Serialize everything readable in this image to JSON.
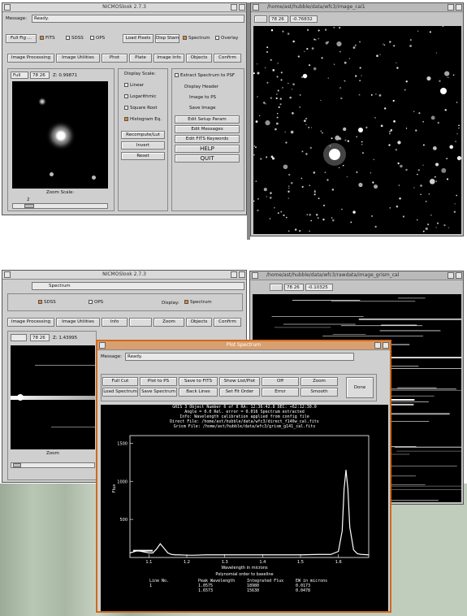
{
  "top_main": {
    "title": "NICMOSlook 2.7.3",
    "message_label": "Message:",
    "message_value": "Ready.",
    "row1": [
      "Full Fig ...",
      "FITS",
      "SDSS",
      "OPS",
      "Load Pixels",
      "Disp Stamp",
      "Spectrum",
      "Overlay"
    ],
    "row2": [
      "Image Processing",
      "Image Utilities",
      "Phot",
      "Plate",
      "Image Info",
      "Objects",
      "Confirm"
    ],
    "zoom_field": "Full",
    "coord_field": "78 26",
    "coord_value": "Z: 0.99871",
    "zoom_label": "Zoom Scale:",
    "zoom_value": "2",
    "display_scale_title": "Display Scale:",
    "scales": [
      "Linear",
      "Logarithmic",
      "Square Root",
      "Histogram Eq."
    ],
    "scale_buttons": [
      "Recompute/Lut",
      "Invert",
      "Reset"
    ],
    "right_options": [
      "Extract Spectrum to PSF",
      "Display Header",
      "Image to PS",
      "Save Image"
    ],
    "right_buttons": [
      "Edit Setup Param",
      "Edit Messages",
      "Edit FITS Keywords",
      "HELP",
      "QUIT"
    ]
  },
  "top_image": {
    "title": "/home/ast/hubble/data/wfc3/image_cal1",
    "coord_field": "78 26",
    "value_field": "-0.76832"
  },
  "bottom_main": {
    "title": "NICMOSlook 2.7.3",
    "status_text": "Spectrum",
    "opts": [
      "SDSS",
      "OPS"
    ],
    "display_label": "Display:",
    "display_value": "Spectrum",
    "row2": [
      "Image Processing",
      "Image Utilities",
      "Info",
      "Zoom",
      "Objects",
      "Confirm"
    ],
    "coord_field": "78 26",
    "coord_value": "Z: 1.43995",
    "zoom_label": "Zoom"
  },
  "bottom_image": {
    "title": "/home/ast/hubble/data/wfc3/rawdata/image_grism_cal",
    "coord_field": "78 26",
    "value_field": "-0.10325"
  },
  "plot_window": {
    "title": "Plot Spectrum",
    "message_label": "Message:",
    "message_value": "Ready.",
    "buttons_row1": [
      "Full Cut",
      "Plot to PS",
      "Save to FITS",
      "Show List/Plot",
      "Off",
      "Zoom"
    ],
    "buttons_row2": [
      "Load Spectrum",
      "Save Spectrum",
      "Back Lines",
      "Set Fit Order",
      "Error",
      "Smooth"
    ],
    "side_button": "Done",
    "header_lines": [
      "GRIS 3   Object Number 6 of 8   RA: 12:36:42.8  DEC: +62:12:30.0",
      "Angle = 0.0  Rel. error = 0.016  Spectrum extracted",
      "Info: Wavelength calibration applied from config file",
      "Direct File: /home/ast/hubble/data/wfc3/direct_f140w_cal.fits",
      "Grism File: /home/ast/hubble/data/wfc3/grism_g141_cal.fits"
    ],
    "x_label": "Wavelength in microns",
    "y_label": "Flux",
    "footer_title": "Polynomial order to baseline",
    "footer_headers": [
      "Line No.",
      "Peak Wavelength",
      "Integrated Flux",
      "EW in microns"
    ],
    "footer_values": [
      "1",
      "1.0575",
      "18980",
      "0.0173"
    ],
    "footer_values2": [
      "",
      "1.6573",
      "15630",
      "0.0478"
    ]
  },
  "chart_data": {
    "type": "line",
    "xlabel": "Wavelength in microns",
    "ylabel": "Flux",
    "yticks": [
      500,
      1000,
      1500
    ],
    "xticks": [
      1.1,
      1.2,
      1.3,
      1.4,
      1.5,
      1.6
    ],
    "xlim": [
      1.05,
      1.68
    ],
    "ylim": [
      0,
      1600
    ],
    "series": [
      {
        "x": [
          1.05,
          1.07,
          1.09,
          1.1,
          1.11,
          1.12,
          1.13,
          1.14,
          1.15,
          1.16,
          1.17,
          1.18,
          1.2,
          1.22,
          1.25,
          1.3,
          1.35,
          1.4,
          1.45,
          1.5,
          1.55,
          1.58,
          1.6,
          1.61,
          1.615,
          1.62,
          1.625,
          1.63,
          1.64,
          1.65,
          1.66,
          1.68
        ],
        "y": [
          60,
          90,
          70,
          60,
          60,
          110,
          180,
          120,
          60,
          40,
          35,
          35,
          30,
          30,
          35,
          35,
          35,
          35,
          35,
          35,
          40,
          40,
          80,
          350,
          900,
          1150,
          900,
          400,
          100,
          50,
          40,
          35
        ]
      }
    ]
  }
}
